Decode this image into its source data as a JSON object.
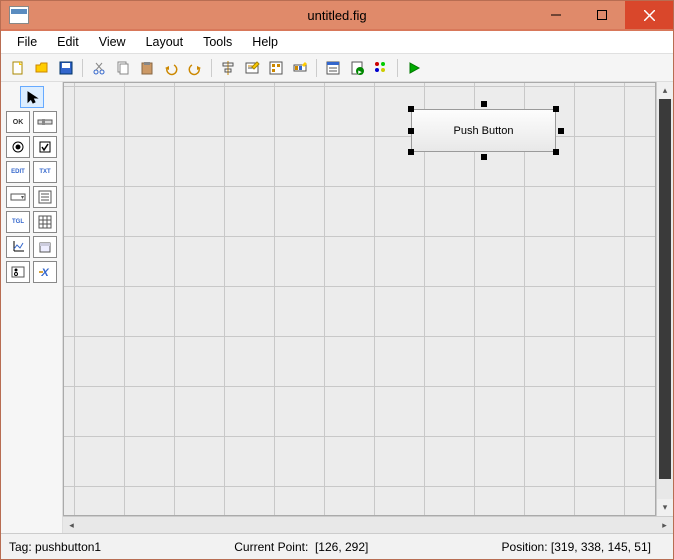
{
  "window": {
    "title": "untitled.fig"
  },
  "menu": {
    "file": "File",
    "edit": "Edit",
    "view": "View",
    "layout": "Layout",
    "tools": "Tools",
    "help": "Help"
  },
  "toolbar": {
    "icons": [
      "new",
      "open",
      "save",
      "cut",
      "copy",
      "paste",
      "undo",
      "redo",
      "align",
      "editor",
      "tab-order",
      "toolbar-ed",
      "menu-ed",
      "m-file",
      "prop-insp",
      "obj-browser",
      "run"
    ]
  },
  "palette": {
    "select": "select",
    "ok": "OK",
    "slider": "≡",
    "radio": "◉",
    "check": "☑",
    "edit": "EDIT",
    "txt": "TXT",
    "popup": "▭",
    "list": "≣",
    "toggle": "TGL",
    "table": "▦",
    "axes": "axes",
    "panel": "panel",
    "bgroup": "bgroup",
    "activex": "X"
  },
  "canvas": {
    "component_label": "Push Button"
  },
  "status": {
    "tag_label": "Tag:",
    "tag_value": "pushbutton1",
    "current_point_label": "Current Point:",
    "current_point_value": "[126, 292]",
    "position_label": "Position:",
    "position_value": "[319, 338, 145, 51]"
  }
}
